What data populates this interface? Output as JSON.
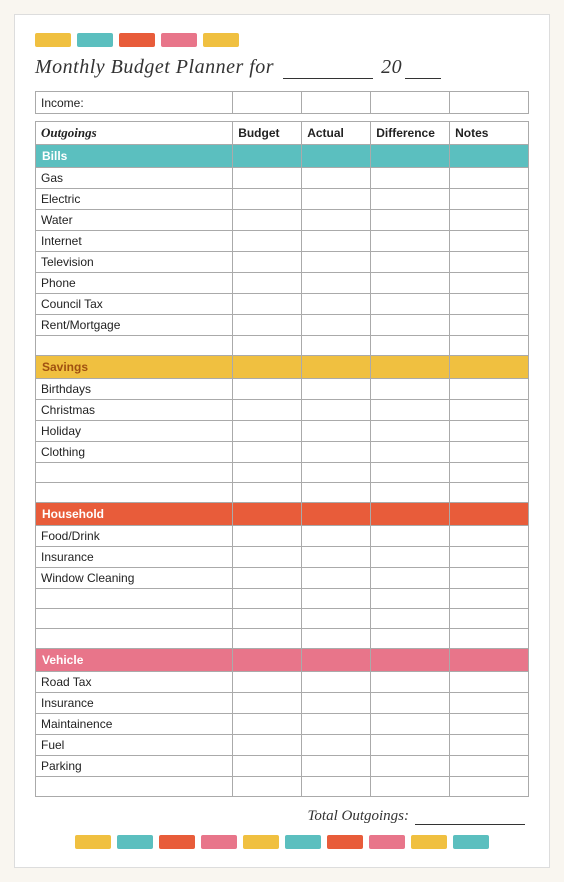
{
  "title": {
    "prefix": "Monthly Budget Planner for",
    "suffix": "20"
  },
  "topDecor": [
    {
      "color": "#f0c040",
      "width": 36
    },
    {
      "color": "#5bbfbf",
      "width": 36
    },
    {
      "color": "#e85c3a",
      "width": 36
    },
    {
      "color": "#e8758a",
      "width": 36
    },
    {
      "color": "#f0c040",
      "width": 36
    }
  ],
  "headers": {
    "outgoings": "Outgoings",
    "budget": "Budget",
    "actual": "Actual",
    "difference": "Difference",
    "notes": "Notes",
    "income": "Income:"
  },
  "categories": {
    "bills": "Bills",
    "savings": "Savings",
    "household": "Household",
    "vehicle": "Vehicle"
  },
  "bills_items": [
    "Gas",
    "Electric",
    "Water",
    "Internet",
    "Television",
    "Phone",
    "Council Tax",
    "Rent/Mortgage"
  ],
  "savings_items": [
    "Birthdays",
    "Christmas",
    "Holiday",
    "Clothing"
  ],
  "household_items": [
    "Food/Drink",
    "Insurance",
    "Window Cleaning"
  ],
  "vehicle_items": [
    "Road Tax",
    "Insurance",
    "Maintainence",
    "Fuel",
    "Parking"
  ],
  "footer": {
    "total_label": "Total Outgoings:"
  },
  "bottomDecor": [
    {
      "color": "#f0c040",
      "width": 36
    },
    {
      "color": "#5bbfbf",
      "width": 36
    },
    {
      "color": "#e85c3a",
      "width": 36
    },
    {
      "color": "#e8758a",
      "width": 36
    },
    {
      "color": "#f0c040",
      "width": 36
    },
    {
      "color": "#5bbfbf",
      "width": 36
    },
    {
      "color": "#e85c3a",
      "width": 36
    },
    {
      "color": "#e8758a",
      "width": 36
    },
    {
      "color": "#f0c040",
      "width": 36
    },
    {
      "color": "#5bbfbf",
      "width": 36
    }
  ]
}
